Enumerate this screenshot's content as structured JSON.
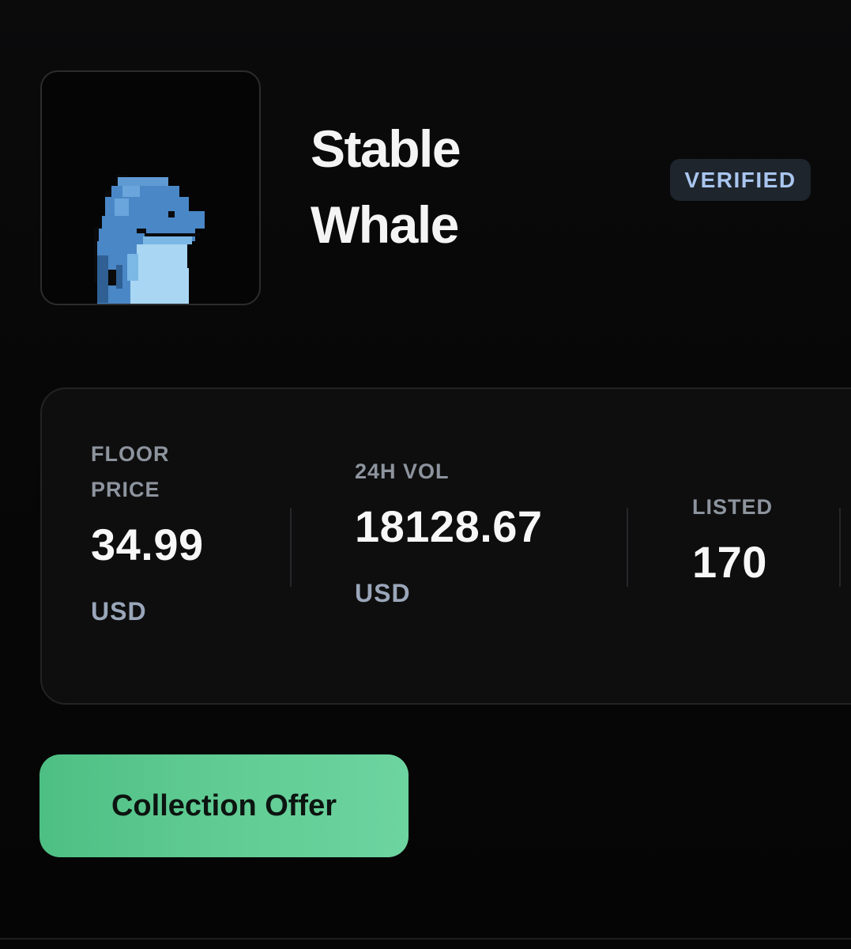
{
  "collection": {
    "name_line1": "Stable",
    "name_line2": "Whale",
    "badge": "VERIFIED",
    "avatar_icon": "pixel-whale-icon"
  },
  "stats": {
    "floor": {
      "label_line1": "FLOOR",
      "label_line2": "PRICE",
      "value": "34.99",
      "unit": "USD"
    },
    "volume": {
      "label": "24H VOL",
      "value": "18128.67",
      "unit": "USD"
    },
    "listed": {
      "label": "LISTED",
      "value": "170"
    }
  },
  "actions": {
    "offer_label": "Collection Offer"
  },
  "colors": {
    "background": "#060606",
    "accent_green": "#5fcb92",
    "badge_text": "#a9c6ef",
    "whale_blue": "#4a87c6",
    "whale_belly": "#a9d6f2"
  }
}
